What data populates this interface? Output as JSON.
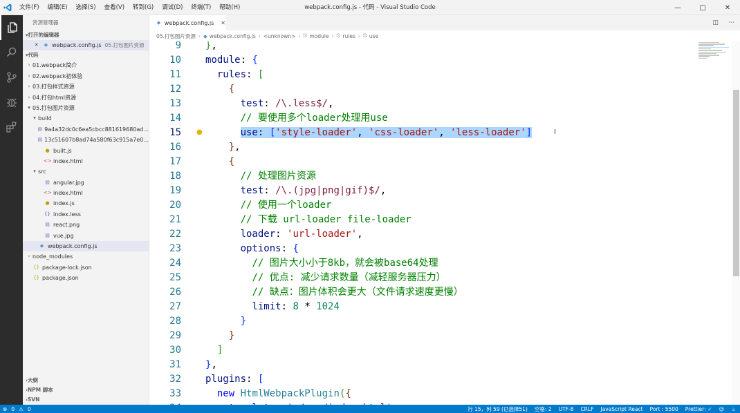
{
  "window": {
    "title": "webpack.config.js - 代码 - Visual Studio Code",
    "menu": [
      "文件(F)",
      "编辑(E)",
      "选择(S)",
      "查看(V)",
      "转到(G)",
      "调试(D)",
      "终端(T)",
      "帮助(H)"
    ]
  },
  "sidebar": {
    "title": "资源管理器",
    "open_editors_label": "打开的编辑器",
    "open_editor": {
      "name": "webpack.config.js",
      "folder": "05.打包图片资源"
    },
    "workspace_label": "代码",
    "tree": [
      {
        "label": "01.webpack简介",
        "depth": 1,
        "kind": "folder-closed"
      },
      {
        "label": "02.webpack初体验",
        "depth": 1,
        "kind": "folder-closed"
      },
      {
        "label": "03.打包样式资源",
        "depth": 1,
        "kind": "folder-closed"
      },
      {
        "label": "04.打包html资源",
        "depth": 1,
        "kind": "folder-closed"
      },
      {
        "label": "05.打包图片资源",
        "depth": 1,
        "kind": "folder-open"
      },
      {
        "label": "build",
        "depth": 2,
        "kind": "folder-open"
      },
      {
        "label": "9a4a32dc0c6ea5cbcc881619680ad...",
        "depth": 3,
        "kind": "img"
      },
      {
        "label": "13c51607b8ad74a580f63c915a7e0...",
        "depth": 3,
        "kind": "img"
      },
      {
        "label": "built.js",
        "depth": 3,
        "kind": "js"
      },
      {
        "label": "index.html",
        "depth": 3,
        "kind": "html"
      },
      {
        "label": "src",
        "depth": 2,
        "kind": "folder-open"
      },
      {
        "label": "angular.jpg",
        "depth": 3,
        "kind": "img"
      },
      {
        "label": "index.html",
        "depth": 3,
        "kind": "html"
      },
      {
        "label": "index.js",
        "depth": 3,
        "kind": "js"
      },
      {
        "label": "index.less",
        "depth": 3,
        "kind": "less"
      },
      {
        "label": "react.png",
        "depth": 3,
        "kind": "img"
      },
      {
        "label": "vue.jpg",
        "depth": 3,
        "kind": "img"
      },
      {
        "label": "webpack.config.js",
        "depth": 2,
        "kind": "cfg",
        "selected": true
      },
      {
        "label": "node_modules",
        "depth": 1,
        "kind": "folder-closed"
      },
      {
        "label": "package-lock.json",
        "depth": 1,
        "kind": "json"
      },
      {
        "label": "package.json",
        "depth": 1,
        "kind": "json"
      }
    ],
    "bottom_sections": [
      "大纲",
      "NPM 脚本",
      "SVN"
    ]
  },
  "editor": {
    "tab_label": "webpack.config.js",
    "breadcrumb": [
      "05.打包图片资源",
      "webpack.config.js",
      "<unknown>",
      "module",
      "rules",
      "use"
    ]
  },
  "status": {
    "errors": "0",
    "warnings": "0",
    "position": "行 15，列 59 (已选择51)",
    "spaces": "空格: 2",
    "encoding": "UTF-8",
    "eol": "CRLF",
    "language": "JavaScript React",
    "port": "Port : 5500",
    "prettier": "Prettier: ✓"
  }
}
